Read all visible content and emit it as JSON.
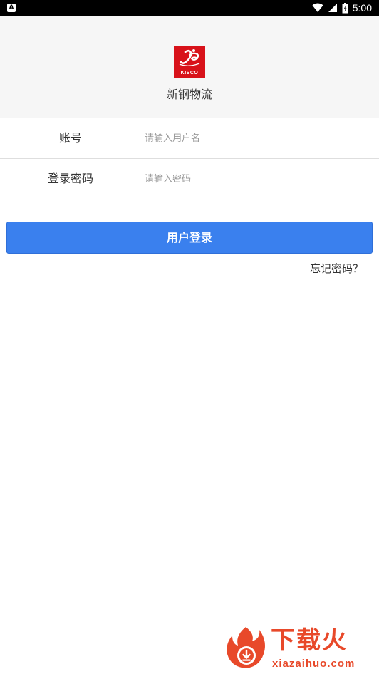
{
  "status_bar": {
    "app_badge": "A",
    "time": "5:00",
    "icons": [
      "wifi-icon",
      "signal-icon",
      "battery-icon"
    ]
  },
  "header": {
    "logo_text": "KISCO",
    "app_name": "新钢物流"
  },
  "form": {
    "account": {
      "label": "账号",
      "placeholder": "请输入用户名",
      "value": ""
    },
    "password": {
      "label": "登录密码",
      "placeholder": "请输入密码",
      "value": ""
    }
  },
  "actions": {
    "login_label": "用户登录",
    "forgot_label": "忘记密码？"
  },
  "watermark": {
    "title": "下载火",
    "url": "xiazaihuo.com"
  },
  "colors": {
    "primary": "#3a80ee",
    "logo_red": "#d8121a",
    "header_bg": "#f6f6f6",
    "watermark": "#e8492a"
  }
}
